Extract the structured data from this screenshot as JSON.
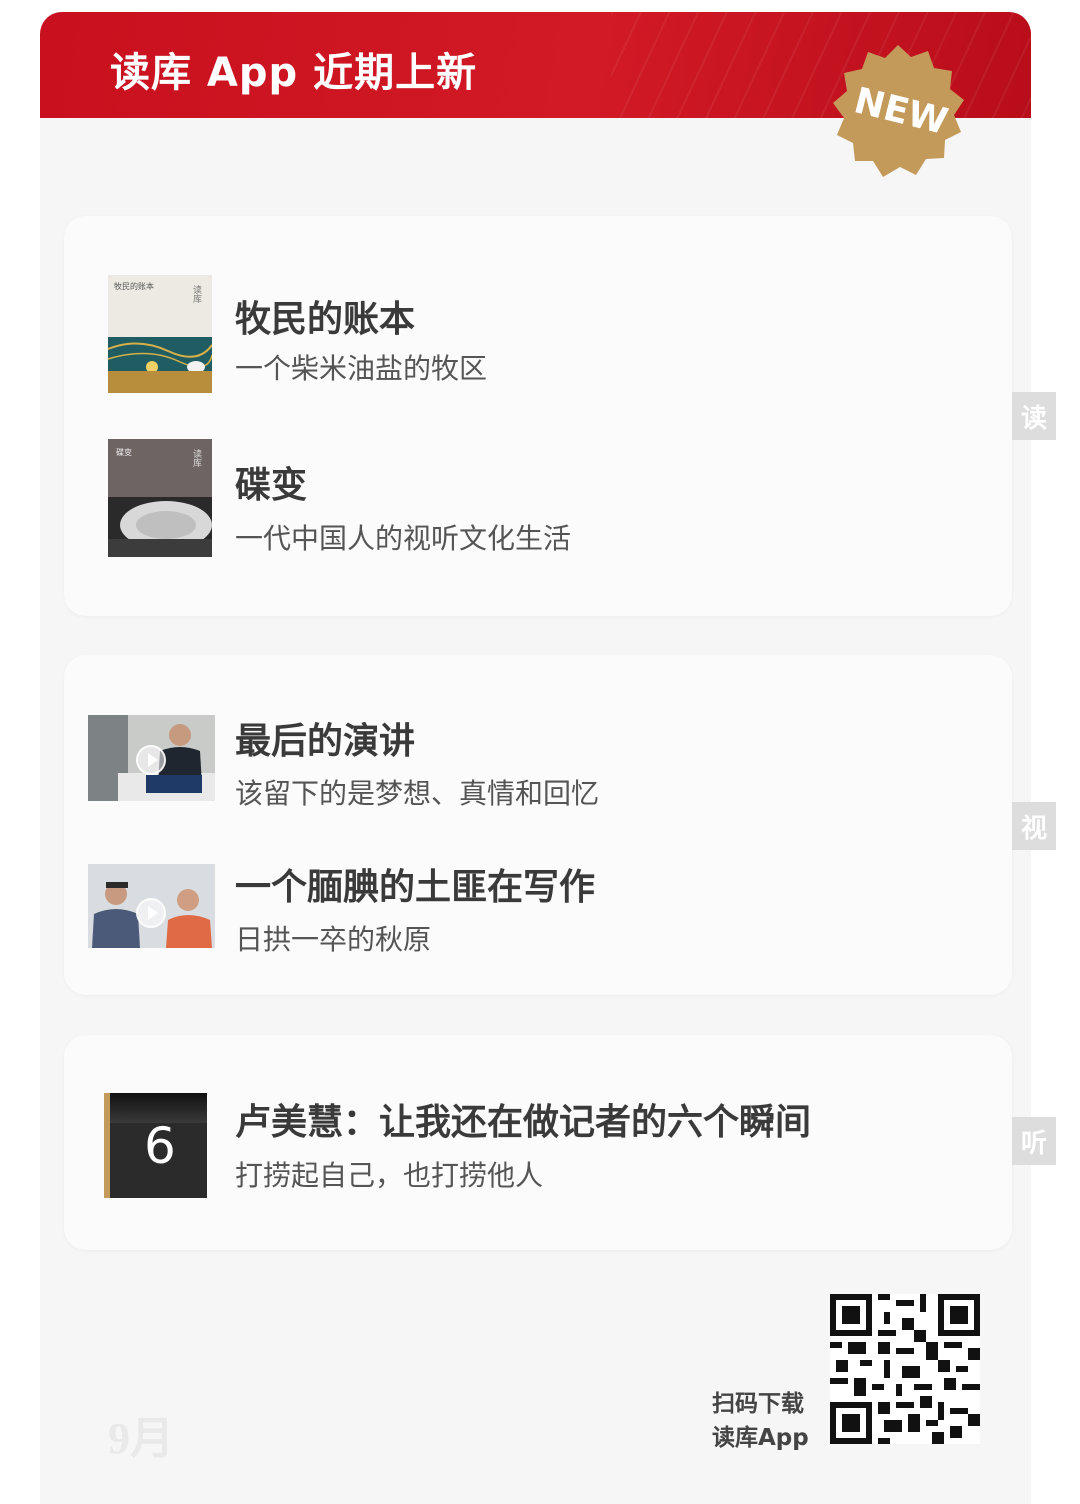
{
  "header": {
    "title": "读库 App 近期上新",
    "badge": "NEW"
  },
  "sections": [
    {
      "tab": "读",
      "items": [
        {
          "title": "牧民的账本",
          "subtitle": "一个柴米油盐的牧区",
          "cover_title": "牧民的账本",
          "cover_mark": "读库"
        },
        {
          "title": "碟变",
          "subtitle": "一代中国人的视听文化生活",
          "cover_title": "碟变",
          "cover_mark": "读库"
        }
      ]
    },
    {
      "tab": "视",
      "items": [
        {
          "title": "最后的演讲",
          "subtitle": "该留下的是梦想、真情和回忆"
        },
        {
          "title": "一个腼腆的土匪在写作",
          "subtitle": "日拱一卒的秋原"
        }
      ]
    },
    {
      "tab": "听",
      "items": [
        {
          "title": "卢美慧：让我还在做记者的六个瞬间",
          "subtitle": "打捞起自己，也打捞他人",
          "cover_number": "6"
        }
      ]
    }
  ],
  "footer": {
    "month": "9月",
    "scan_line1": "扫码下载",
    "scan_line2": "读库App"
  },
  "colors": {
    "header_red": "#c8101e",
    "badge_gold": "#c49a5a",
    "tab_gray": "#dddddd"
  }
}
